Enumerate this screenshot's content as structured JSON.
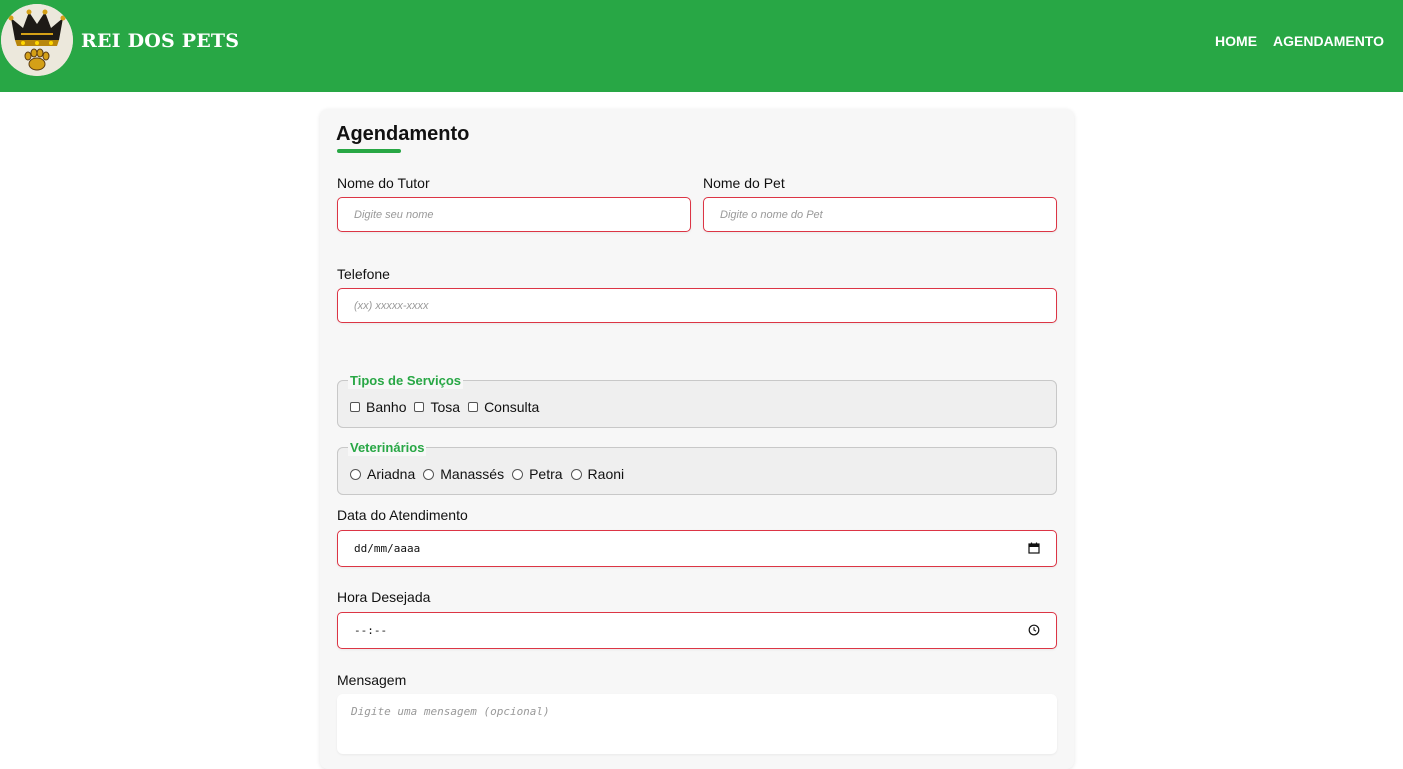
{
  "header": {
    "brand": "REI DOS PETS",
    "logo_icon": "crown-paw-logo-icon",
    "nav": [
      {
        "label": "HOME"
      },
      {
        "label": "AGENDAMENTO"
      }
    ],
    "color": "#28a745"
  },
  "form": {
    "title": "Agendamento",
    "tutor": {
      "label": "Nome do Tutor",
      "placeholder": "Digite seu nome"
    },
    "pet": {
      "label": "Nome do Pet",
      "placeholder": "Digite o nome do Pet"
    },
    "phone": {
      "label": "Telefone",
      "placeholder": "(xx) xxxxx-xxxx"
    },
    "services": {
      "legend": "Tipos de Serviços",
      "options": [
        {
          "label": "Banho"
        },
        {
          "label": "Tosa"
        },
        {
          "label": "Consulta"
        }
      ]
    },
    "vets": {
      "legend": "Veterinários",
      "options": [
        {
          "label": "Ariadna"
        },
        {
          "label": "Manassés"
        },
        {
          "label": "Petra"
        },
        {
          "label": "Raoni"
        }
      ]
    },
    "date": {
      "label": "Data do Atendimento",
      "placeholder": "dd/mm/aaaa",
      "icon": "calendar-icon"
    },
    "time": {
      "label": "Hora Desejada",
      "placeholder": "--:--",
      "icon": "clock-icon"
    },
    "message": {
      "label": "Mensagem",
      "placeholder": "Digite uma mensagem (opcional)"
    }
  }
}
